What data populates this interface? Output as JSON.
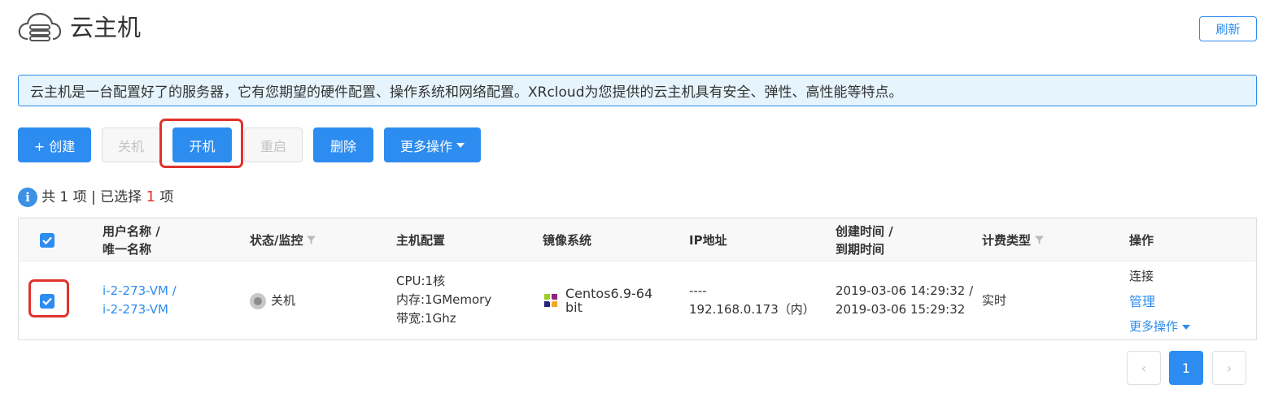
{
  "header": {
    "title": "云主机",
    "refresh_label": "刷新"
  },
  "banner": {
    "text": "云主机是一台配置好了的服务器，它有您期望的硬件配置、操作系统和网络配置。XRcloud为您提供的云主机具有安全、弹性、高性能等特点。"
  },
  "toolbar": {
    "create_label": "+ 创建",
    "stop_label": "关机",
    "start_label": "开机",
    "restart_label": "重启",
    "delete_label": "删除",
    "more_label": "更多操作"
  },
  "summary": {
    "info_glyph": "i",
    "prefix": "共 1 项 | 已选择 ",
    "selected": "1",
    "suffix": " 项"
  },
  "table": {
    "headers": {
      "name_line1": "用户名称 /",
      "name_line2": "唯一名称",
      "status": "状态/监控",
      "config": "主机配置",
      "image": "镜像系统",
      "ip": "IP地址",
      "time_line1": "创建时间 /",
      "time_line2": "到期时间",
      "billing": "计费类型",
      "actions": "操作"
    },
    "rows": [
      {
        "name_user": "i-2-273-VM /",
        "name_unique": "i-2-273-VM",
        "status": "关机",
        "cpu": "CPU:1核",
        "memory": "内存:1GMemory",
        "bandwidth": "带宽:1Ghz",
        "image_line1": "Centos6.9-64",
        "image_line2": "bit",
        "ip_public": "----",
        "ip_private": "192.168.0.173（内）",
        "created": "2019-03-06 14:29:32 /",
        "expires": "2019-03-06 15:29:32",
        "billing": "实时",
        "action_connect": "连接",
        "action_manage": "管理",
        "action_more": "更多操作"
      }
    ]
  },
  "pagination": {
    "current_page": "1",
    "prev_glyph": "‹",
    "next_glyph": "›"
  },
  "colors": {
    "primary": "#2d8cf0",
    "highlight": "#e0322c",
    "banner_bg": "#e6f4fd"
  }
}
